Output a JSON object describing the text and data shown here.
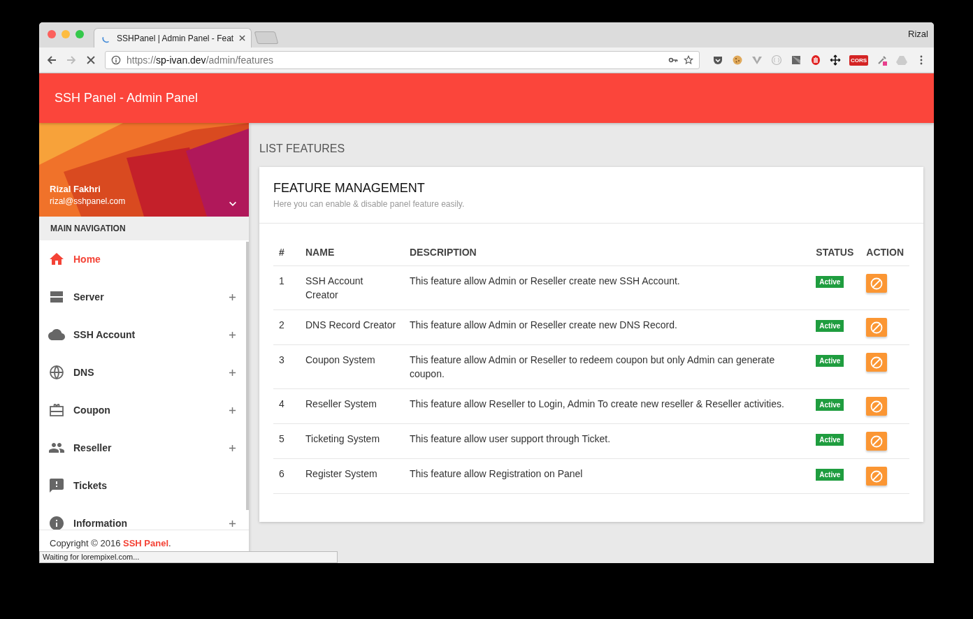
{
  "browser": {
    "tab_title": "SSHPanel | Admin Panel - Feat",
    "profile": "Rizal",
    "url_scheme": "https://",
    "url_host": "sp-ivan.dev",
    "url_path": "/admin/features",
    "cors_label": "CORS",
    "status_text": "Waiting for lorempixel.com..."
  },
  "header": {
    "title": "SSH Panel - Admin Panel"
  },
  "user": {
    "name": "Rizal Fakhri",
    "email": "rizal@sshpanel.com"
  },
  "nav": {
    "heading": "MAIN NAVIGATION",
    "items": [
      {
        "label": "Home",
        "selected": true,
        "expandable": false
      },
      {
        "label": "Server",
        "selected": false,
        "expandable": true
      },
      {
        "label": "SSH Account",
        "selected": false,
        "expandable": true
      },
      {
        "label": "DNS",
        "selected": false,
        "expandable": true
      },
      {
        "label": "Coupon",
        "selected": false,
        "expandable": true
      },
      {
        "label": "Reseller",
        "selected": false,
        "expandable": true
      },
      {
        "label": "Tickets",
        "selected": false,
        "expandable": false
      },
      {
        "label": "Information",
        "selected": false,
        "expandable": true
      }
    ]
  },
  "footer": {
    "copyright": "Copyright © 2016 **SSH Panel**."
  },
  "page_title": "LIST FEATURES",
  "card": {
    "title": "FEATURE MANAGEMENT",
    "subtitle": "Here you can enable & disable panel feature easily.",
    "columns": [
      "#",
      "NAME",
      "DESCRIPTION",
      "STATUS",
      "ACTION"
    ],
    "rows": [
      {
        "number": "1",
        "name": "SSH Account Creator",
        "description": "This feature allow Admin or Reseller create new SSH Account.",
        "status": "Active"
      },
      {
        "number": "2",
        "name": "DNS Record Creator",
        "description": "This feature allow Admin or Reseller create new DNS Record.",
        "status": "Active"
      },
      {
        "number": "3",
        "name": "Coupon System",
        "description": "This feature allow Admin or Reseller to redeem coupon but only Admin can generate coupon.",
        "status": "Active"
      },
      {
        "number": "4",
        "name": "Reseller System",
        "description": "This feature allow Reseller to Login, Admin To create new reseller & Reseller activities.",
        "status": "Active"
      },
      {
        "number": "5",
        "name": "Ticketing System",
        "description": "This feature allow user support through Ticket.",
        "status": "Active"
      },
      {
        "number": "6",
        "name": "Register System",
        "description": "This feature allow Registration on Panel",
        "status": "Active"
      }
    ]
  }
}
